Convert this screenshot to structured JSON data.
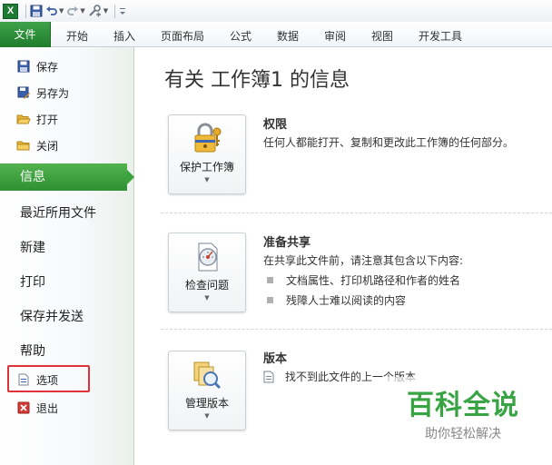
{
  "qat": {
    "logo_text": "X",
    "icons": [
      "excel-logo-icon",
      "save-icon",
      "undo-icon",
      "redo-icon",
      "customize-icon"
    ]
  },
  "ribbon": {
    "tabs": [
      "文件",
      "开始",
      "插入",
      "页面布局",
      "公式",
      "数据",
      "审阅",
      "视图",
      "开发工具"
    ]
  },
  "nav": {
    "small_items": [
      {
        "label": "保存",
        "icon": "save-icon"
      },
      {
        "label": "另存为",
        "icon": "save-as-icon"
      },
      {
        "label": "打开",
        "icon": "folder-open-icon"
      },
      {
        "label": "关闭",
        "icon": "folder-close-icon"
      }
    ],
    "active": "信息",
    "big_items": [
      "最近所用文件",
      "新建",
      "打印",
      "保存并发送",
      "帮助"
    ],
    "bottom_items": [
      {
        "label": "选项",
        "icon": "options-icon"
      },
      {
        "label": "退出",
        "icon": "exit-icon"
      }
    ],
    "highlight_color": "#e0323a"
  },
  "main": {
    "title": "有关 工作簿1 的信息",
    "sections": [
      {
        "button": "保护工作簿",
        "title": "权限",
        "description": "任何人都能打开、复制和更改此工作簿的任何部分。"
      },
      {
        "button": "检查问题",
        "title": "准备共享",
        "description": "在共享此文件前，请注意其包含以下内容:",
        "bullets": [
          "文档属性、打印机路径和作者的姓名",
          "残障人士难以阅读的内容"
        ]
      },
      {
        "button": "管理版本",
        "title": "版本",
        "item": "找不到此文件的上一个版本"
      }
    ]
  },
  "watermark": {
    "main": "百科全说",
    "sub": "助你轻松解决",
    "color": "#38a444"
  },
  "colors": {
    "accent_green": "#2f8f32"
  }
}
